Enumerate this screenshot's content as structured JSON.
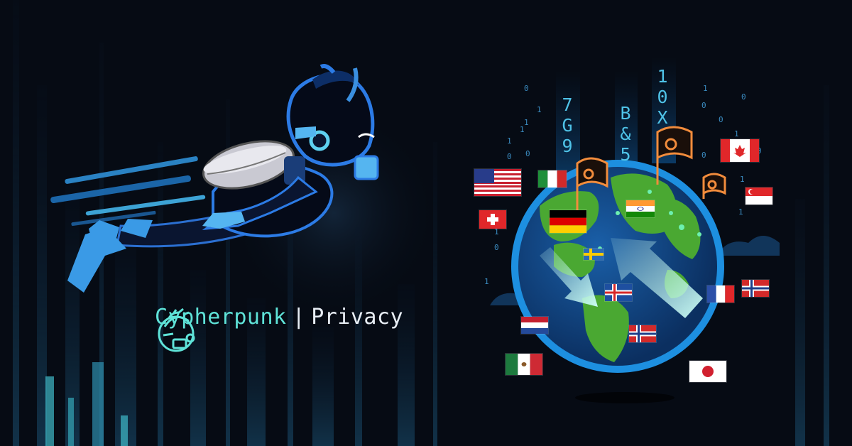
{
  "brand": {
    "name": "Cypherpunk",
    "separator": "|",
    "tagline": "Privacy"
  },
  "code_columns": [
    {
      "id": "left",
      "text": "7\nG\n9"
    },
    {
      "id": "mid",
      "text": "B\n&\n5"
    },
    {
      "id": "right",
      "text": "1\n0\nX"
    }
  ],
  "binary_digits": [
    "0",
    "1",
    "1",
    "0",
    "1",
    "0",
    "1",
    "1",
    "0",
    "1",
    "1",
    "0",
    "0",
    "0",
    "1",
    "0",
    "1",
    "1",
    "0"
  ],
  "flags": [
    {
      "id": "usa",
      "icon": "usa-flag-icon"
    },
    {
      "id": "italy",
      "icon": "italy-flag-icon"
    },
    {
      "id": "switzerland",
      "icon": "switzerland-flag-icon"
    },
    {
      "id": "germany",
      "icon": "germany-flag-icon"
    },
    {
      "id": "india",
      "icon": "india-flag-icon"
    },
    {
      "id": "canada",
      "icon": "canada-flag-icon"
    },
    {
      "id": "singapore",
      "icon": "singapore-flag-icon"
    },
    {
      "id": "sweden",
      "icon": "sweden-flag-icon"
    },
    {
      "id": "iceland",
      "icon": "iceland-flag-icon"
    },
    {
      "id": "france",
      "icon": "france-flag-icon"
    },
    {
      "id": "norway",
      "icon": "norway-flag-icon"
    },
    {
      "id": "netherlands",
      "icon": "netherlands-flag-icon"
    },
    {
      "id": "mexico",
      "icon": "mexico-flag-icon"
    },
    {
      "id": "japan",
      "icon": "japan-flag-icon"
    }
  ],
  "colors": {
    "background": "#060b14",
    "accent_cyan": "#5fe3d8",
    "accent_blue": "#3aa8e0",
    "key_flag_orange": "#f28c3c",
    "globe_ocean": "#0f3f7a",
    "globe_land": "#4aa832"
  }
}
